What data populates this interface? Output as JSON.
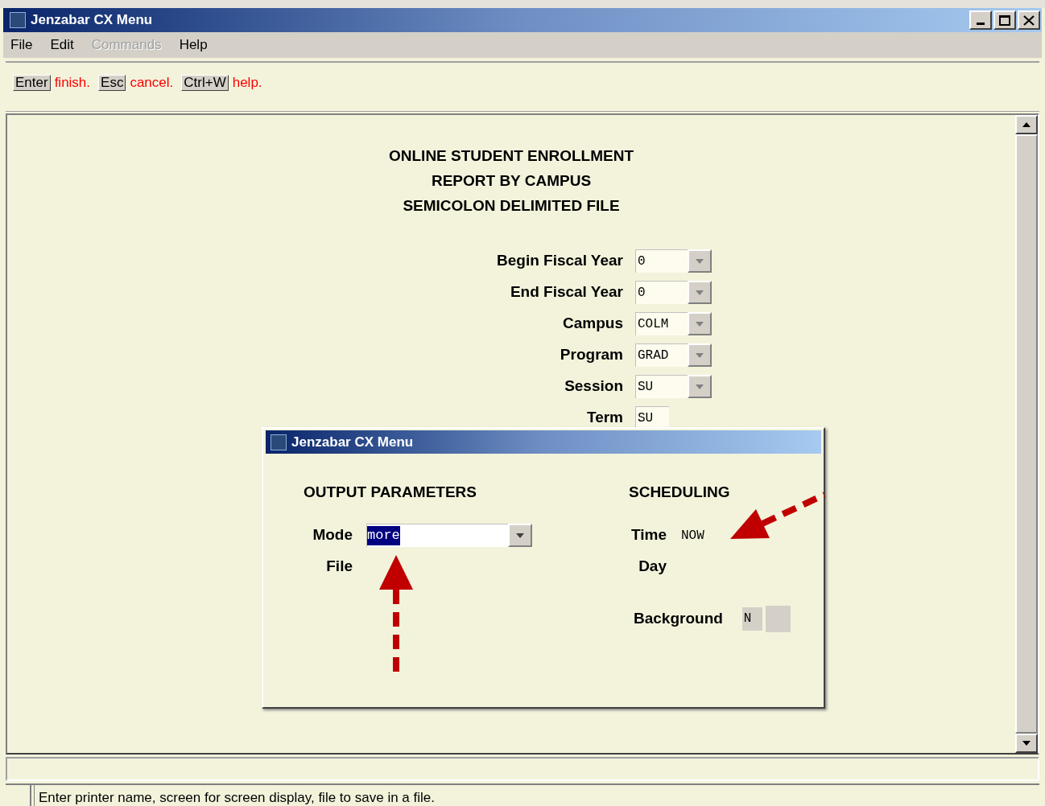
{
  "window": {
    "title": "Jenzabar CX Menu"
  },
  "menu": [
    {
      "label": "File",
      "disabled": false
    },
    {
      "label": "Edit",
      "disabled": false
    },
    {
      "label": "Commands",
      "disabled": true
    },
    {
      "label": "Help",
      "disabled": false
    }
  ],
  "hints": [
    {
      "key": "Enter",
      "action": "finish."
    },
    {
      "key": "Esc",
      "action": "cancel."
    },
    {
      "key": "Ctrl+W",
      "action": "help."
    }
  ],
  "report": {
    "title_lines": [
      "ONLINE STUDENT ENROLLMENT",
      "REPORT BY CAMPUS",
      "SEMICOLON DELIMITED FILE"
    ]
  },
  "fields": [
    {
      "label": "Begin Fiscal Year",
      "value": "0",
      "kind": "dropdown"
    },
    {
      "label": "End Fiscal Year",
      "value": "0",
      "kind": "dropdown"
    },
    {
      "label": "Campus",
      "value": "COLM",
      "kind": "dropdown"
    },
    {
      "label": "Program",
      "value": "GRAD",
      "kind": "dropdown"
    },
    {
      "label": "Session",
      "value": "SU",
      "kind": "dropdown"
    },
    {
      "label": "Term",
      "value": "SU",
      "kind": "text"
    }
  ],
  "dialog": {
    "title": "Jenzabar CX Menu",
    "sections": [
      {
        "heading": "OUTPUT PARAMETERS",
        "fields": [
          {
            "label": "Mode",
            "value": "more",
            "kind": "dropdown",
            "selected": true
          },
          {
            "label": "File",
            "kind": "empty"
          }
        ]
      },
      {
        "heading": "SCHEDULING",
        "fields": [
          {
            "label": "Time",
            "value": "NOW",
            "kind": "readonly"
          },
          {
            "label": "Day",
            "kind": "empty"
          },
          {
            "label": "Background",
            "value": "N",
            "kind": "flag"
          }
        ]
      }
    ]
  },
  "status_bar": {
    "message": "Enter printer name, screen for screen display, file to save in a file."
  }
}
